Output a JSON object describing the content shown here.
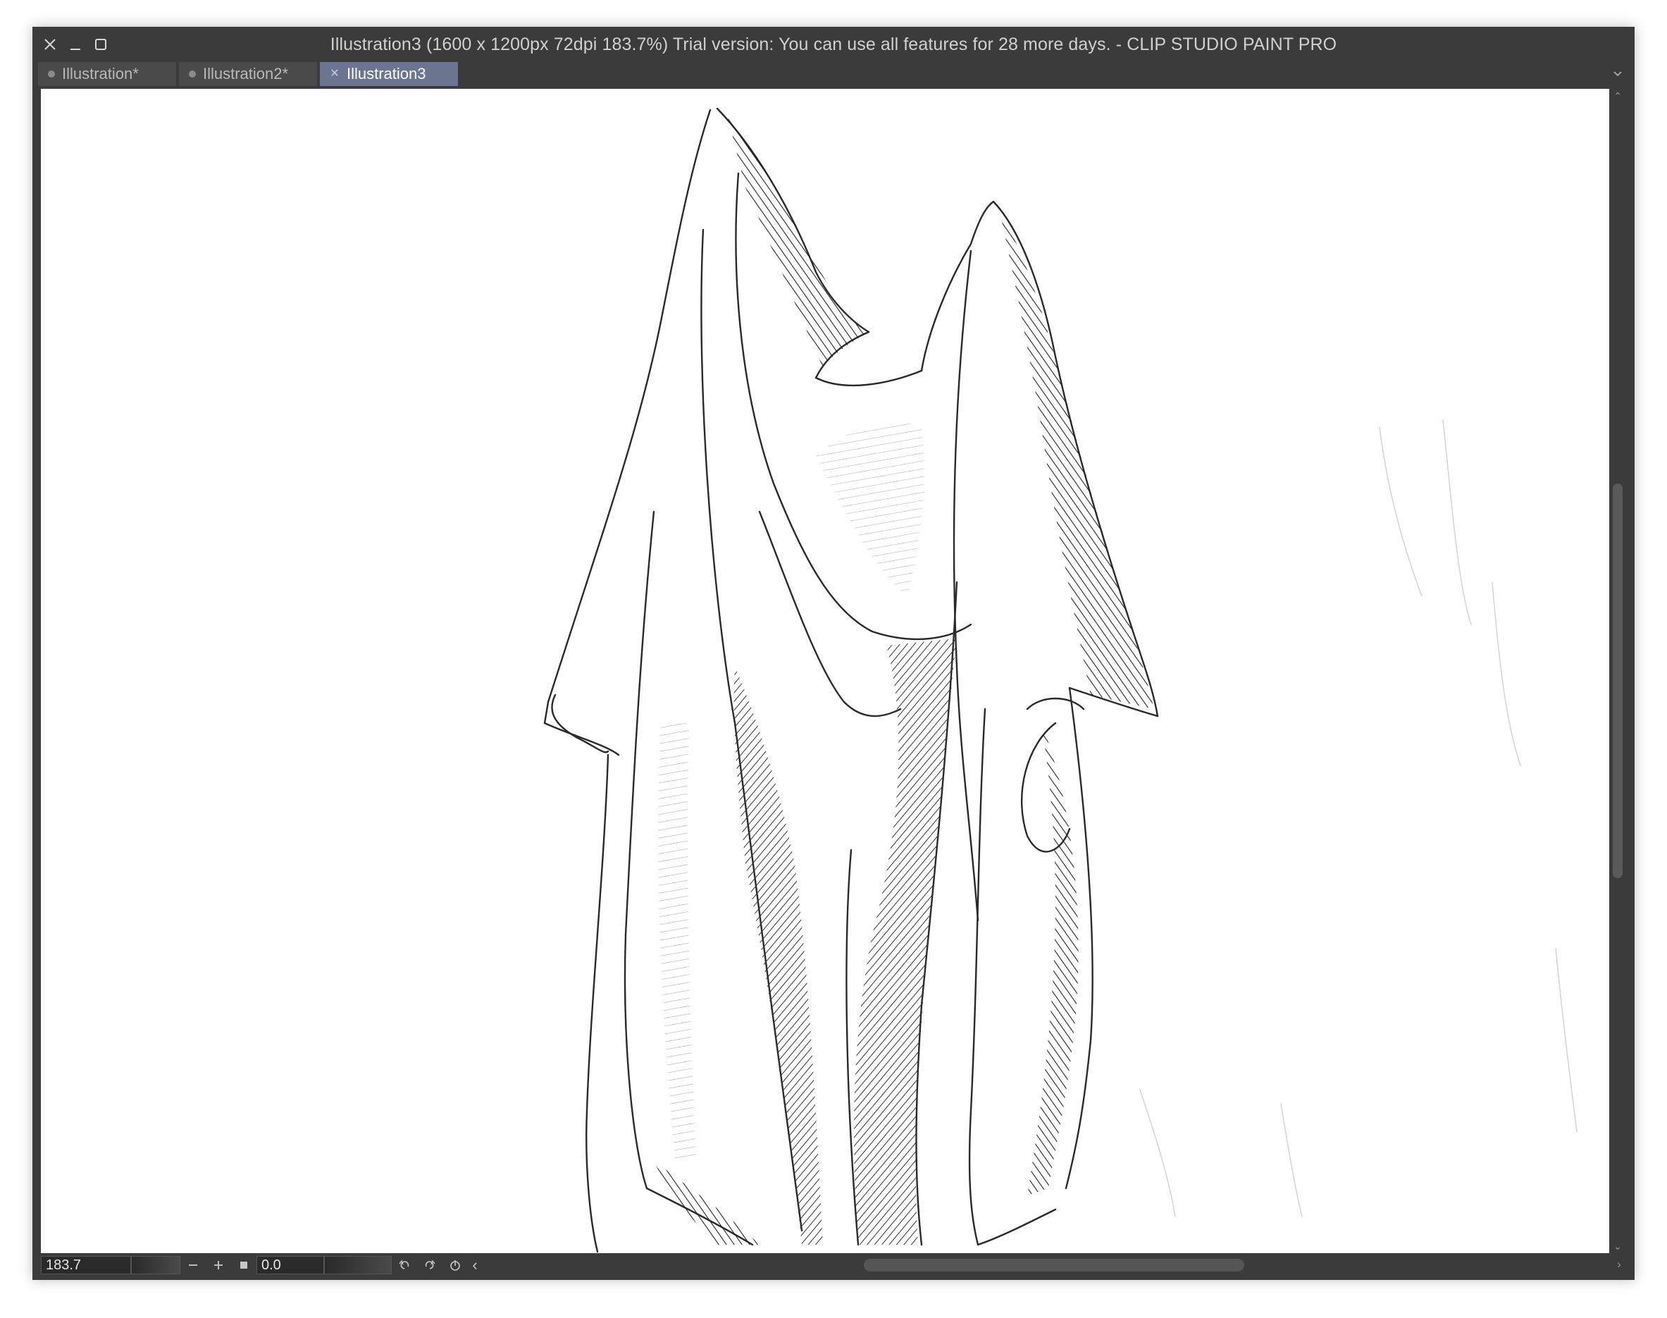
{
  "window": {
    "title": "Illustration3 (1600 x 1200px 72dpi 183.7%)  Trial version: You can use all features for 28 more days. - CLIP STUDIO PAINT PRO"
  },
  "tabs": [
    {
      "label": "Illustration*",
      "active": false
    },
    {
      "label": "Illustration2*",
      "active": false
    },
    {
      "label": "Illustration3",
      "active": true
    }
  ],
  "canvas": {
    "content": "pencil-sketch-drapery"
  },
  "statusbar": {
    "zoom_value": "183.7",
    "rotation_value": "0.0"
  },
  "colors": {
    "chrome": "#3b3b3b",
    "active_tab": "#6b7590",
    "canvas": "#ffffff",
    "sketch": "#2a2a2a"
  }
}
